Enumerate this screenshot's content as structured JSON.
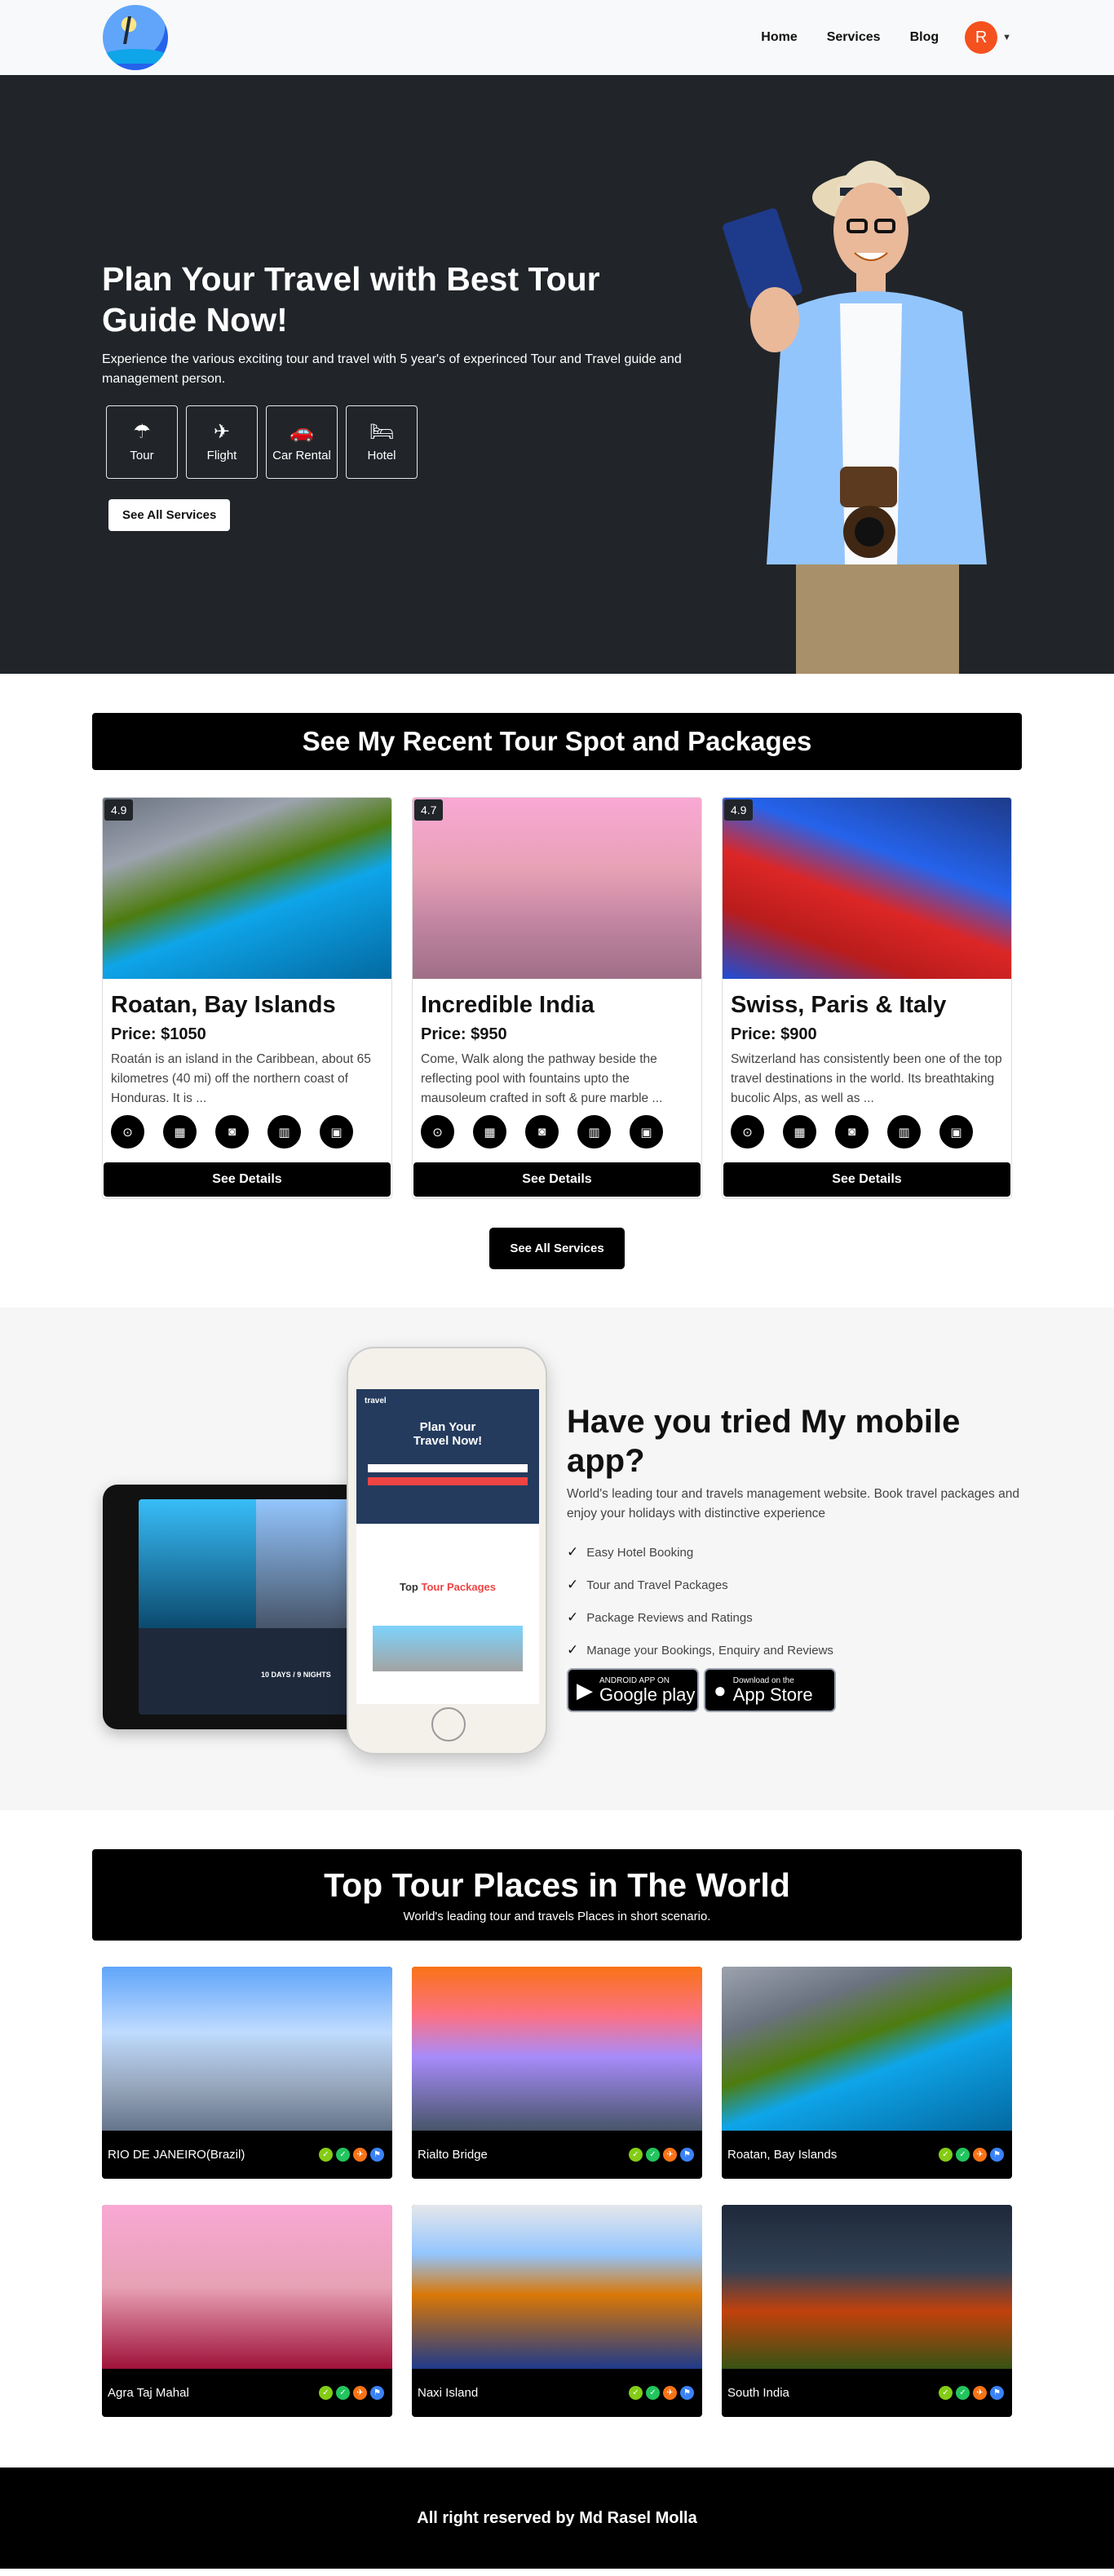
{
  "nav": {
    "links": [
      "Home",
      "Services",
      "Blog"
    ],
    "avatar_initial": "R"
  },
  "hero": {
    "title": "Plan Your Travel with Best Tour Guide Now!",
    "description": "Experience the various exciting tour and travel with 5 year's of experinced Tour and Travel guide and management person.",
    "categories": [
      {
        "label": "Tour",
        "icon": "umbrella-beach-icon"
      },
      {
        "label": "Flight",
        "icon": "plane-icon"
      },
      {
        "label": "Car Rental",
        "icon": "car-icon"
      },
      {
        "label": "Hotel",
        "icon": "bed-icon"
      }
    ],
    "button": "See All Services"
  },
  "tours": {
    "title": "See My Recent Tour Spot and Packages",
    "cards": [
      {
        "rating": "4.9",
        "title": "Roatan, Bay Islands",
        "price": "Price: $1050",
        "desc": "Roatán is an island in the Caribbean, about 65 kilometres (40 mi) off the northern coast of Honduras. It is ...",
        "details": "See Details"
      },
      {
        "rating": "4.7",
        "title": "Incredible India",
        "price": "Price: $950",
        "desc": "Come, Walk along the pathway beside the reflecting pool with fountains upto the mausoleum crafted in soft & pure marble ...",
        "details": "See Details"
      },
      {
        "rating": "4.9",
        "title": "Swiss, Paris & Italy",
        "price": "Price: $900",
        "desc": "Switzerland has consistently been one of the top travel destinations in the world. Its breathtaking bucolic Alps, as well as ...",
        "details": "See Details"
      }
    ],
    "card_icons": [
      "binoculars-icon",
      "hotel-icon",
      "bus-icon",
      "chart-icon",
      "calendar-icon"
    ],
    "all_button": "See All Services"
  },
  "app": {
    "title": "Have you tried My mobile app?",
    "description": "World's leading tour and travels management website. Book travel packages and enjoy your holidays with distinctive experience",
    "features": [
      "Easy Hotel Booking",
      "Tour and Travel Packages",
      "Package Reviews and Ratings",
      "Manage your Bookings, Enquiry and Reviews"
    ],
    "phone_hero": "Plan Your Travel Now!",
    "phone_brand": "travel",
    "phone_top": "Top",
    "phone_top_accent": "Tour Packages",
    "tablet_caption": "10 DAYS / 9 NIGHTS",
    "google": {
      "small": "ANDROID APP ON",
      "big": "Google play"
    },
    "apple": {
      "small": "Download on the",
      "big": "App Store"
    }
  },
  "places": {
    "title": "Top Tour Places in The World",
    "subtitle": "World's leading tour and travels Places in short scenario.",
    "items": [
      {
        "name": "RIO DE JANEIRO(Brazil)"
      },
      {
        "name": "Rialto Bridge"
      },
      {
        "name": "Roatan, Bay Islands"
      },
      {
        "name": "Agra Taj Mahal"
      },
      {
        "name": "Naxi Island"
      },
      {
        "name": "South India"
      }
    ]
  },
  "footer": {
    "text": "All right reserved by Md Rasel Molla"
  }
}
